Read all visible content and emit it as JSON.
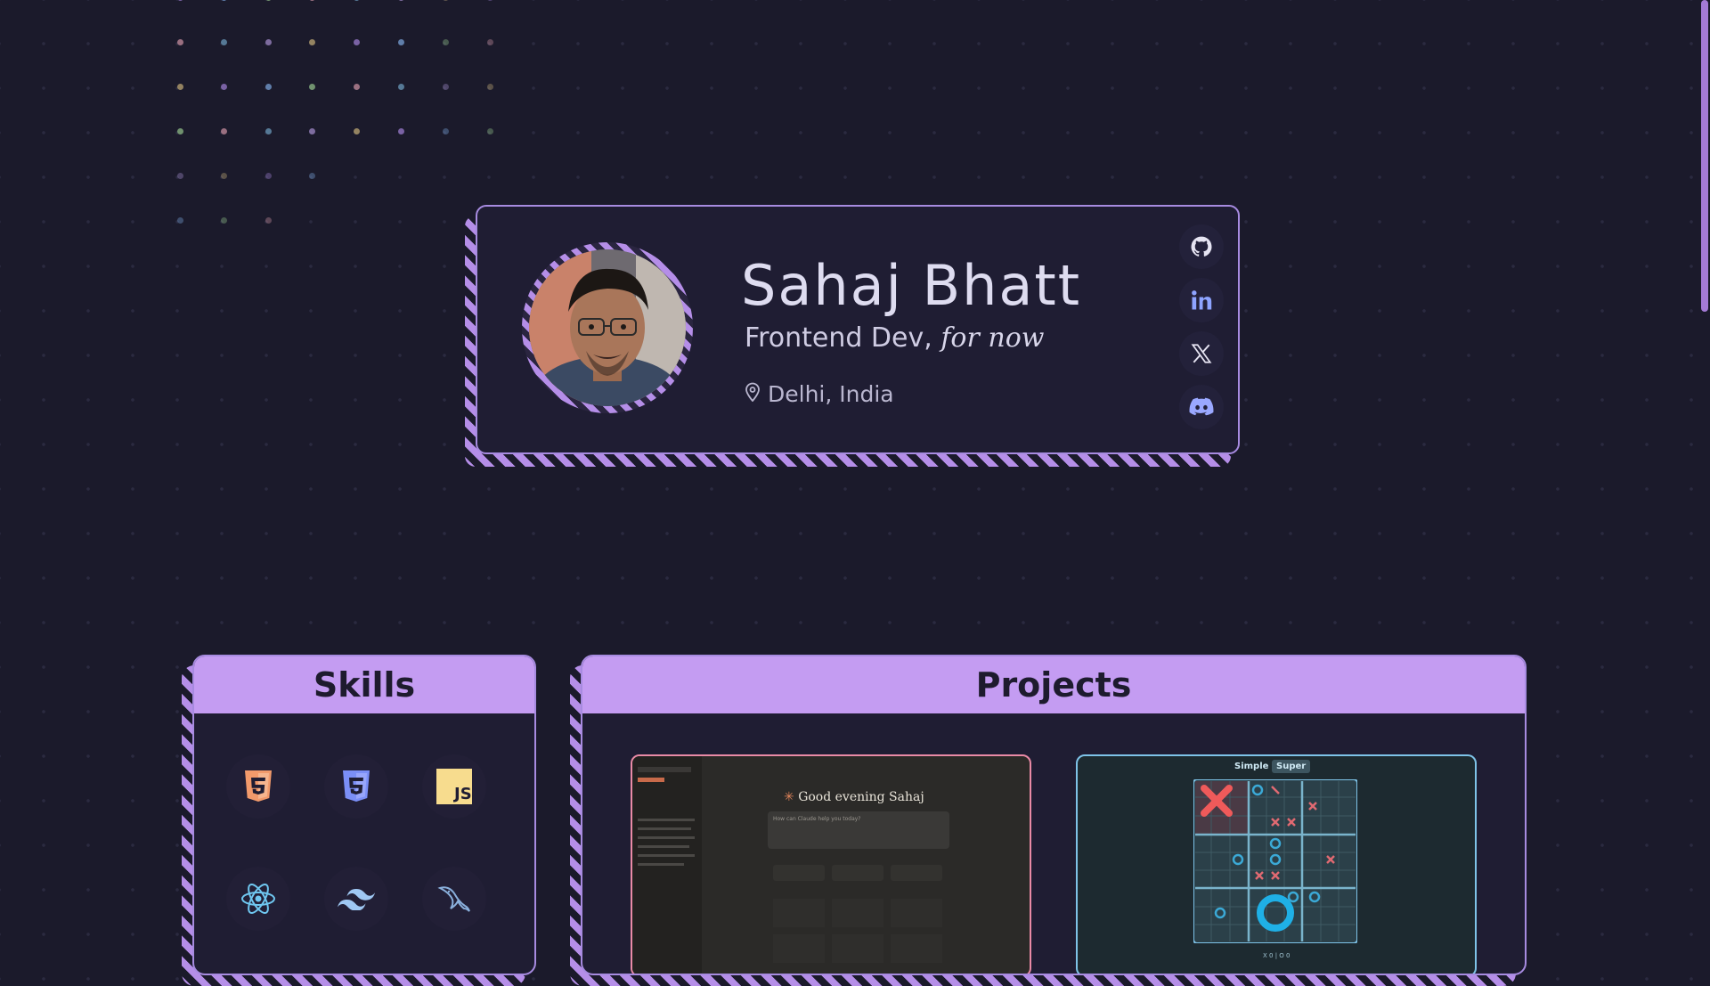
{
  "profile": {
    "name": "Sahaj Bhatt",
    "role_prefix": "Frontend Dev,",
    "role_suffix": "for now",
    "location": "Delhi, India",
    "avatar_alt": "avatar photo",
    "socials": [
      {
        "name": "github",
        "icon": "github-icon"
      },
      {
        "name": "linkedin",
        "icon": "linkedin-icon"
      },
      {
        "name": "x",
        "icon": "x-icon"
      },
      {
        "name": "discord",
        "icon": "discord-icon"
      }
    ]
  },
  "skills": {
    "title": "Skills",
    "items": [
      "html5-icon",
      "css3-icon",
      "javascript-icon",
      "react-icon",
      "tailwind-icon",
      "mysql-icon"
    ],
    "js_label": "JS"
  },
  "projects": {
    "title": "Projects",
    "chat_app": {
      "greeting": "Good evening Sahaj",
      "prompt_placeholder": "How can Claude help you today?"
    },
    "tictactoe": {
      "tab_simple": "Simple",
      "tab_super": "Super",
      "footer": "X 0 | O 0"
    }
  },
  "colors": {
    "accent": "#c49cf2",
    "background": "#1b1a2b",
    "card": "#1f1d33"
  }
}
